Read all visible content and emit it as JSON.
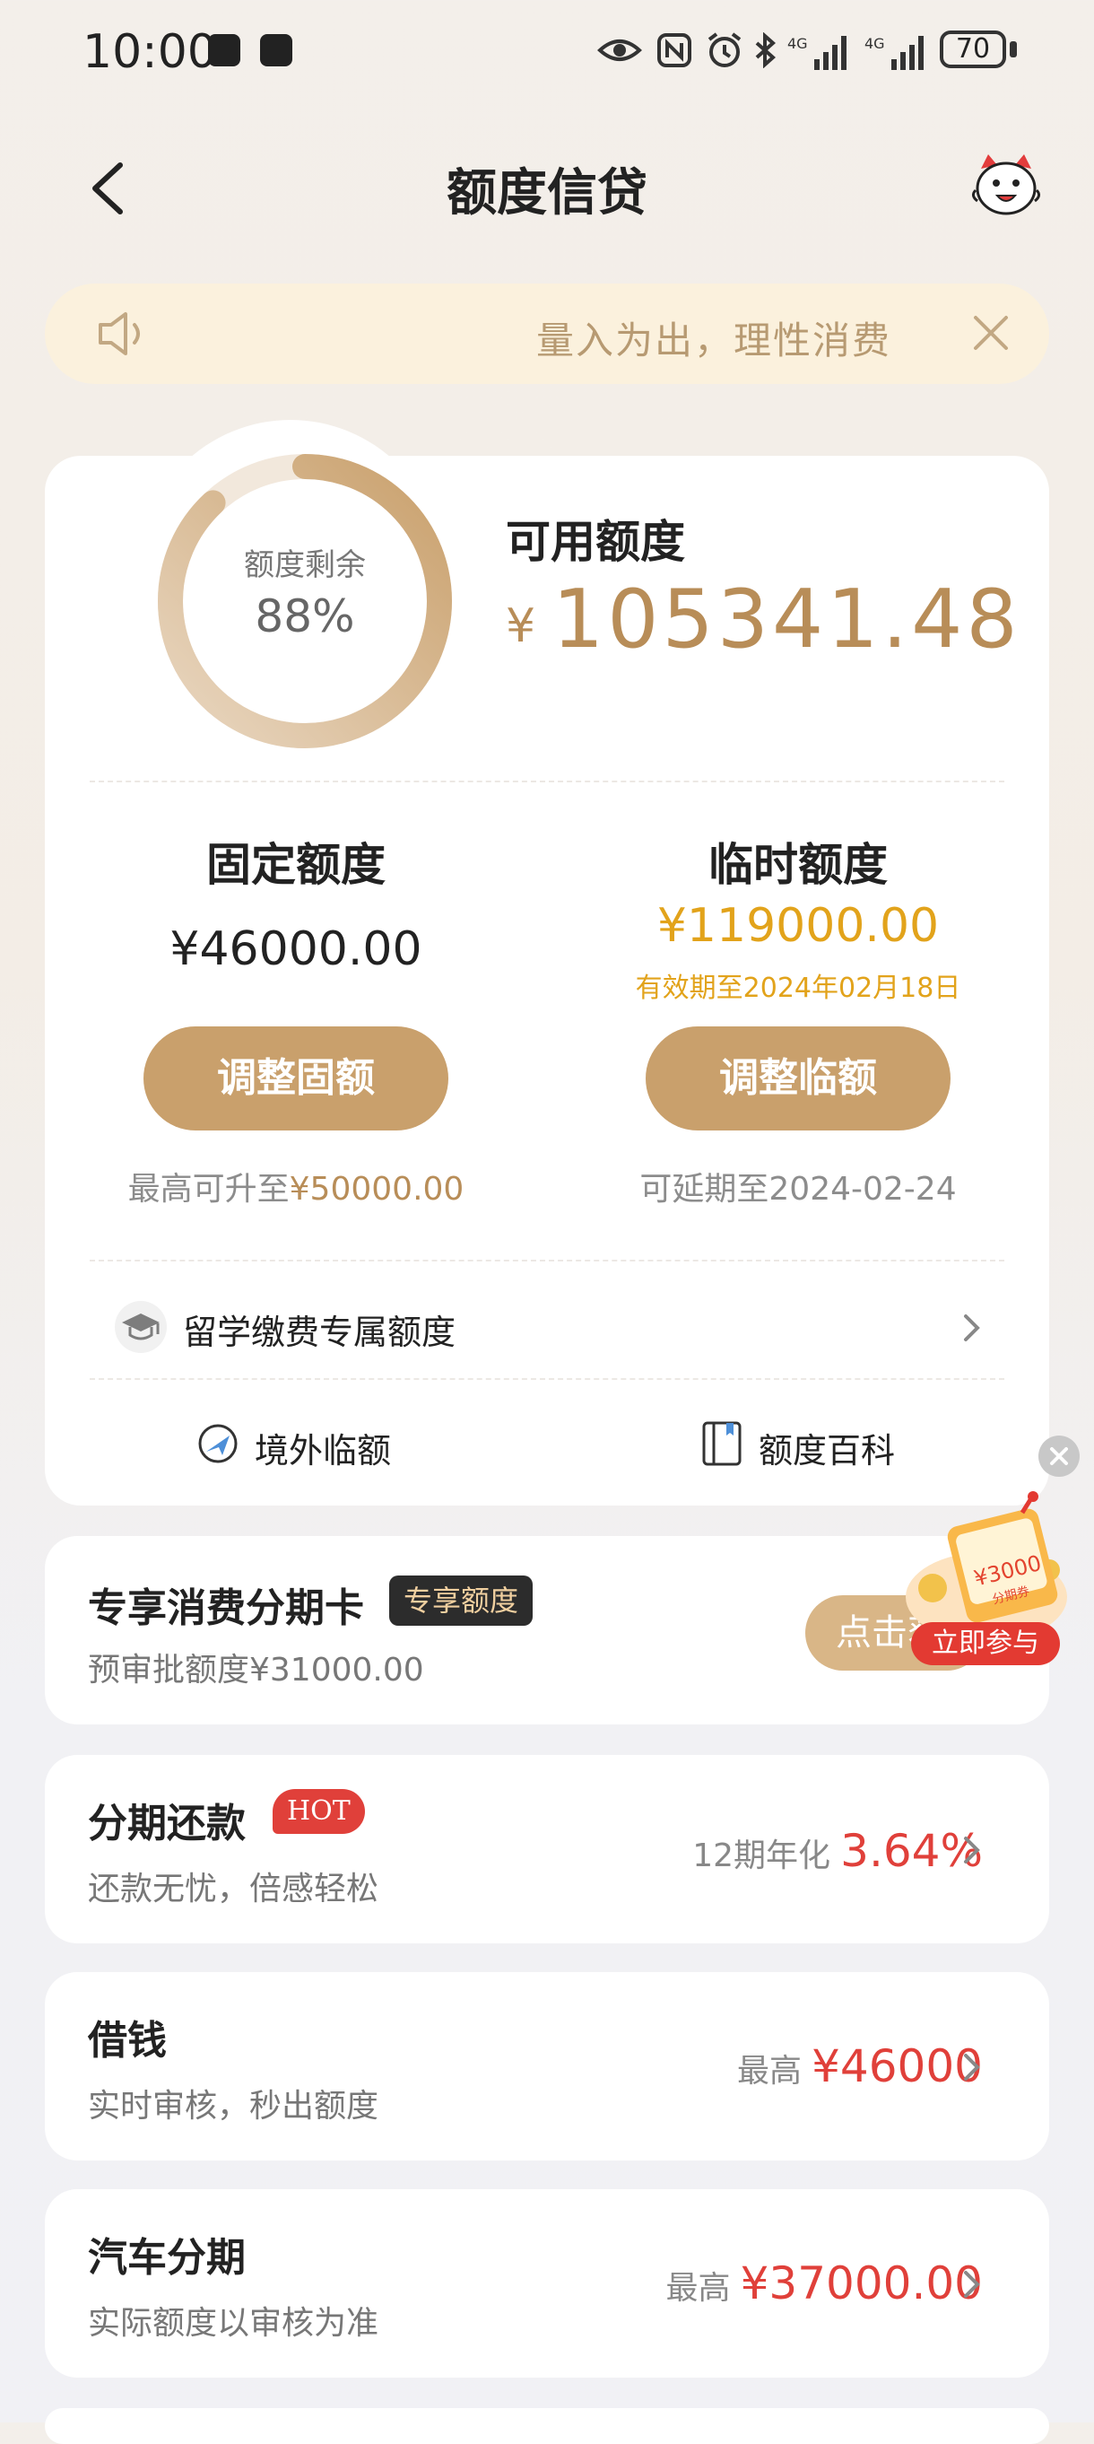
{
  "status_bar": {
    "time": "10:00",
    "network": "4G",
    "battery": "70"
  },
  "header": {
    "title": "额度信贷",
    "back_icon": "chevron-left-icon",
    "mascot_icon": "mascot-icon"
  },
  "notice": {
    "text": "量入为出，理性消费",
    "icon": "speaker-icon"
  },
  "credit": {
    "ring_label": "额度剩余",
    "ring_percent": "88%",
    "ring_fraction": 0.88,
    "available_label": "可用额度",
    "available_currency": "¥",
    "available_value": "105341.48",
    "fixed": {
      "title": "固定额度",
      "amount": "¥46000.00",
      "button": "调整固额",
      "note_prefix": "最高可升至",
      "note_value": "¥50000.00"
    },
    "temporary": {
      "title": "临时额度",
      "amount": "¥119000.00",
      "valid": "有效期至2024年02月18日",
      "button": "调整临额",
      "note": "可延期至2024-02-24"
    },
    "study_row": "留学缴费专属额度",
    "links": [
      "境外临额",
      "额度百科"
    ]
  },
  "cards": {
    "installment_card": {
      "title": "专享消费分期卡",
      "badge": "专享额度",
      "sub": "预审批额度¥31000.00",
      "button": "点击获",
      "promo_amount": "¥3000",
      "promo_label": "分期券",
      "promo_join": "立即参与"
    },
    "repay": {
      "title": "分期还款",
      "badge": "HOT",
      "sub": "还款无忧，倍感轻松",
      "right_label": "12期年化",
      "right_value": "3.64%"
    },
    "borrow": {
      "title": "借钱",
      "sub": "实时审核，秒出额度",
      "right_label": "最高",
      "right_value": "¥46000"
    },
    "car": {
      "title": "汽车分期",
      "sub": "实际额度以审核为准",
      "right_label": "最高",
      "right_value": "¥37000.00"
    }
  },
  "colors": {
    "gold": "#b88d58",
    "button": "#c9a06c",
    "temp_yellow": "#e2a31b",
    "red": "#e0403a",
    "notice_bg": "#fbf1dd"
  }
}
